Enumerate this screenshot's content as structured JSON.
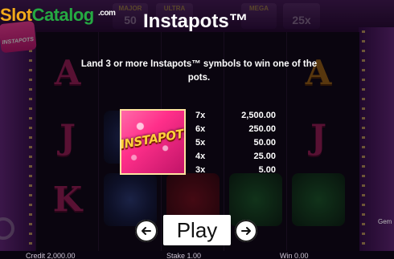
{
  "brand": {
    "part_a": "Slot",
    "part_b": "Catalog",
    "domain": ".com"
  },
  "title": "Instapots™",
  "description": "Land 3 or more Instapots™ symbols to win one of the pots.",
  "symbol": {
    "label": "INSTAPOTS",
    "name": "instapots-symbol"
  },
  "paytable": [
    {
      "mult": "7x",
      "value": "2,500.00"
    },
    {
      "mult": "6x",
      "value": "250.00"
    },
    {
      "mult": "5x",
      "value": "50.00"
    },
    {
      "mult": "4x",
      "value": "25.00"
    },
    {
      "mult": "3x",
      "value": "5.00"
    }
  ],
  "play_button": "Play",
  "jackpots_background": [
    {
      "tag": "MAJOR",
      "value": "50"
    },
    {
      "tag": "ULTRA",
      "value": ""
    },
    {
      "tag": "MEGA",
      "value": ""
    },
    {
      "tag": "",
      "value": "25x"
    }
  ],
  "status": {
    "credit": "Credit  2,000.00",
    "stake": "Stake  1.00",
    "win": "Win  0.00"
  },
  "side_label": "Gem",
  "colors": {
    "accent": "#ff2f8a",
    "brand_orange": "#f2a91b",
    "brand_green": "#25a942"
  }
}
